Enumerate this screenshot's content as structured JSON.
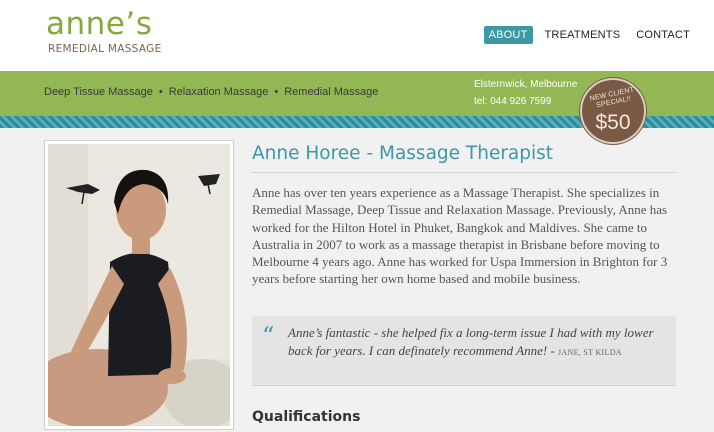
{
  "logo": {
    "name": "anne’s",
    "subtitle": "REMEDIAL MASSAGE"
  },
  "nav": {
    "items": [
      {
        "label": "ABOUT",
        "active": true
      },
      {
        "label": "TREATMENTS",
        "active": false
      },
      {
        "label": "CONTACT",
        "active": false
      }
    ]
  },
  "services": [
    "Deep Tissue Massage",
    "Relaxation Massage",
    "Remedial Massage"
  ],
  "contact": {
    "location": "Elsternwick, Melbourne",
    "tel": "tel: 044 926 7599"
  },
  "badge": {
    "line1": "NEW CLIENT SPECIAL!!",
    "price": "$50"
  },
  "main": {
    "title": "Anne Horee - Massage Therapist",
    "bio": "Anne has over ten years experience as a Massage Therapist. She specializes in Remedial Massage, Deep Tissue and Relaxation Massage. Previously, Anne has worked for the Hilton Hotel in Phuket, Bangkok and Maldives. She came to Australia in 2007 to work as a massage therapist in Brisbane before moving to Melbourne 4 years ago. Anne has worked for Uspa Immersion in Brighton for 3 years before starting her own home based and mobile business.",
    "quote": {
      "mark": "“",
      "text": "Anne’s fantastic - she helped fix a long-term issue I had with my lower back for years. I can definately recommend Anne! -",
      "author": "JANE, ST KILDA"
    },
    "qualifications_heading": "Qualifications"
  },
  "colors": {
    "accent": "#3d97a5",
    "brand_green": "#94b755",
    "badge": "#7a5a44"
  }
}
